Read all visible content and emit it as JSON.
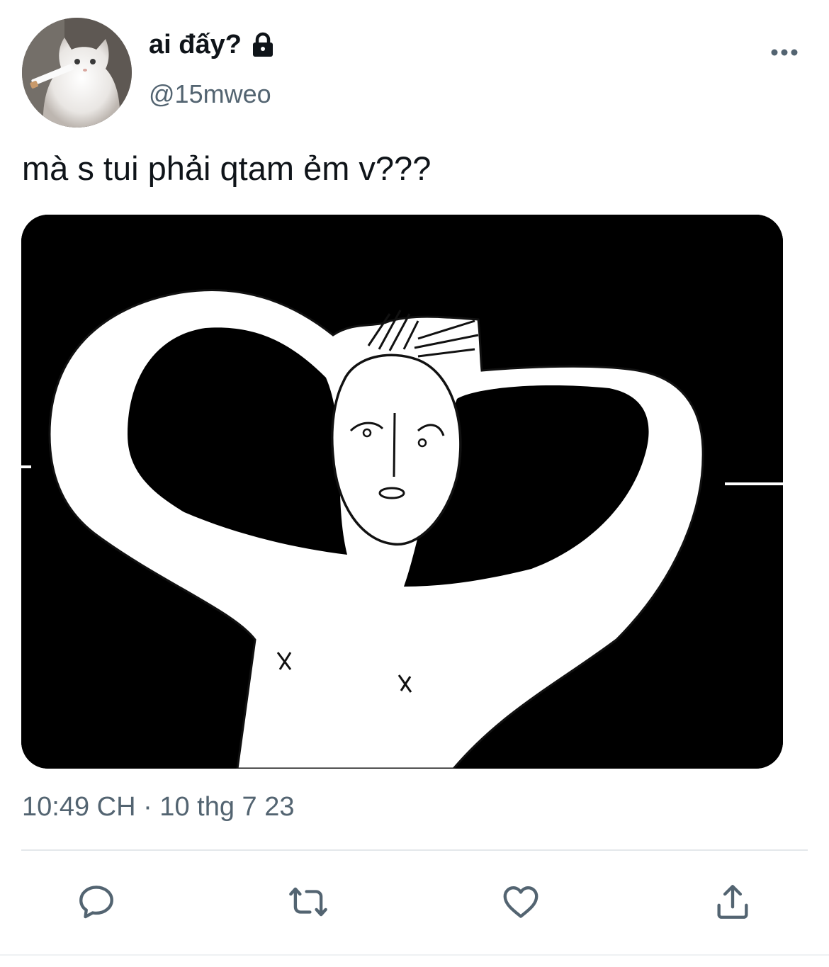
{
  "tweet": {
    "display_name": "ai đấy?",
    "handle": "@15mweo",
    "text": "mà s tui phải qtam ẻm v???",
    "timestamp": "10:49 CH · 10 thg 7 23",
    "icons": {
      "lock": "lock-icon",
      "more": "more-horizontal-icon"
    }
  },
  "actions": [
    {
      "name": "reply",
      "icon": "reply-icon"
    },
    {
      "name": "retweet",
      "icon": "retweet-icon"
    },
    {
      "name": "like",
      "icon": "heart-icon"
    },
    {
      "name": "share",
      "icon": "share-icon"
    }
  ],
  "colors": {
    "text_primary": "#0f1419",
    "text_secondary": "#536471",
    "divider": "#e4e8eb",
    "media_background": "#000000"
  }
}
